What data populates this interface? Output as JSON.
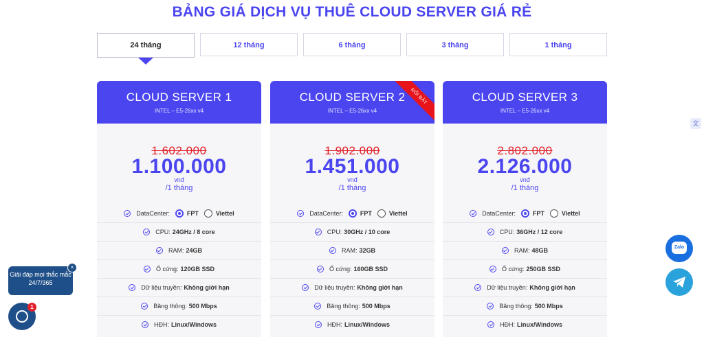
{
  "page": {
    "title": "BẢNG GIÁ DỊCH VỤ THUÊ CLOUD SERVER GIÁ RẺ"
  },
  "tabs": [
    {
      "label": "24 tháng",
      "active": true
    },
    {
      "label": "12 tháng",
      "active": false
    },
    {
      "label": "6 tháng",
      "active": false
    },
    {
      "label": "3 tháng",
      "active": false
    },
    {
      "label": "1 tháng",
      "active": false
    }
  ],
  "labels": {
    "datacenter": "DataCenter:",
    "fpt": "FPT",
    "viettel": "Viettel",
    "cpu": "CPU:",
    "ram": "RAM:",
    "disk": "Ổ cứng:",
    "transfer": "Dữ liệu truyền:",
    "bandwidth": "Băng thông:",
    "os": "HĐH:"
  },
  "plans": [
    {
      "name": "CLOUD SERVER 1",
      "cpu_model": "INTEL – E5-26xx v4",
      "old_price": "1.602.000",
      "price": "1.100.000",
      "currency": "vnđ",
      "period": "/1 tháng",
      "badge": "",
      "cpu": "24GHz / 8 core",
      "ram": "24GB",
      "disk": "120GB SSD",
      "transfer": "Không giới hạn",
      "bandwidth": "500 Mbps",
      "os": "Linux/Windows",
      "selected_datacenter": "FPT"
    },
    {
      "name": "CLOUD SERVER 2",
      "cpu_model": "INTEL – E5-26xx v4",
      "old_price": "1.902.000",
      "price": "1.451.000",
      "currency": "vnđ",
      "period": "/1 tháng",
      "badge": "NỔI BẬT",
      "cpu": "30GHz / 10 core",
      "ram": "32GB",
      "disk": "160GB SSD",
      "transfer": "Không giới hạn",
      "bandwidth": "500 Mbps",
      "os": "Linux/Windows",
      "selected_datacenter": "FPT"
    },
    {
      "name": "CLOUD SERVER 3",
      "cpu_model": "INTEL – E5-26xx v4",
      "old_price": "2.802.000",
      "price": "2.126.000",
      "currency": "vnđ",
      "period": "/1 tháng",
      "badge": "",
      "cpu": "36GHz / 12 core",
      "ram": "48GB",
      "disk": "250GB SSD",
      "transfer": "Không giới hạn",
      "bandwidth": "500 Mbps",
      "os": "Linux/Windows",
      "selected_datacenter": "FPT"
    }
  ],
  "widgets": {
    "chat_prompt": "Giải đáp mọi thắc mắc 24/7/365",
    "chat_close": "×",
    "chat_badge": "1",
    "zalo_label": "Zalo",
    "translate_icon": "translate-icon"
  },
  "colors": {
    "accent": "#4b45f0",
    "strike_price": "#e2202a",
    "ribbon": "#e8141c",
    "card_bg": "#f6f6f8",
    "chat": "#1f4f88"
  }
}
